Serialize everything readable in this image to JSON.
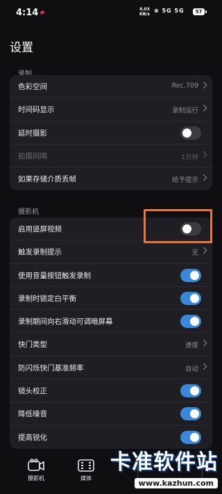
{
  "status_bar": {
    "time": "4:14",
    "net_speed_value": "0.03",
    "net_speed_unit": "KB/s",
    "icons_text": "⊗ 5G 5G",
    "battery": "57"
  },
  "page_title": "设置",
  "sections": [
    {
      "title": "录制",
      "rows": [
        {
          "label": "色彩空间",
          "value": "Rec.709",
          "type": "link"
        },
        {
          "label": "时间码显示",
          "value": "录制运行",
          "type": "link"
        },
        {
          "label": "延时摄影",
          "type": "toggle",
          "on": false
        },
        {
          "label": "拍摄间隔",
          "value": "1分钟",
          "type": "link",
          "disabled": true
        },
        {
          "label": "如果存储介质丢帧",
          "value": "给予提示",
          "type": "link"
        }
      ]
    },
    {
      "title": "摄影机",
      "rows": [
        {
          "label": "启用竖屏视频",
          "type": "toggle",
          "on": false
        },
        {
          "label": "触发录制提示",
          "value": "无",
          "type": "link"
        },
        {
          "label": "使用音量按钮触发录制",
          "type": "toggle",
          "on": true
        },
        {
          "label": "录制时锁定白平衡",
          "type": "toggle",
          "on": true
        },
        {
          "label": "录制期间向右滑动可调暗屏幕",
          "type": "toggle",
          "on": true
        },
        {
          "label": "快门类型",
          "value": "速度",
          "type": "link"
        },
        {
          "label": "防闪烁快门基准频率",
          "value": "自动",
          "type": "link"
        },
        {
          "label": "镜头校正",
          "type": "toggle",
          "on": true
        },
        {
          "label": "降低噪音",
          "type": "toggle",
          "on": true
        },
        {
          "label": "提高锐化",
          "type": "toggle",
          "on": true
        }
      ]
    }
  ],
  "bottom_nav": [
    {
      "label": "摄影机",
      "icon": "camera-icon"
    },
    {
      "label": "媒体",
      "icon": "film-icon"
    }
  ],
  "watermark": {
    "text": "卡准软件站",
    "url": "www.kazhun.com"
  },
  "colors": {
    "background": "#0f0f12",
    "card": "#1e1e23",
    "toggle_on": "#3a88d8",
    "highlight": "#e8763e"
  }
}
